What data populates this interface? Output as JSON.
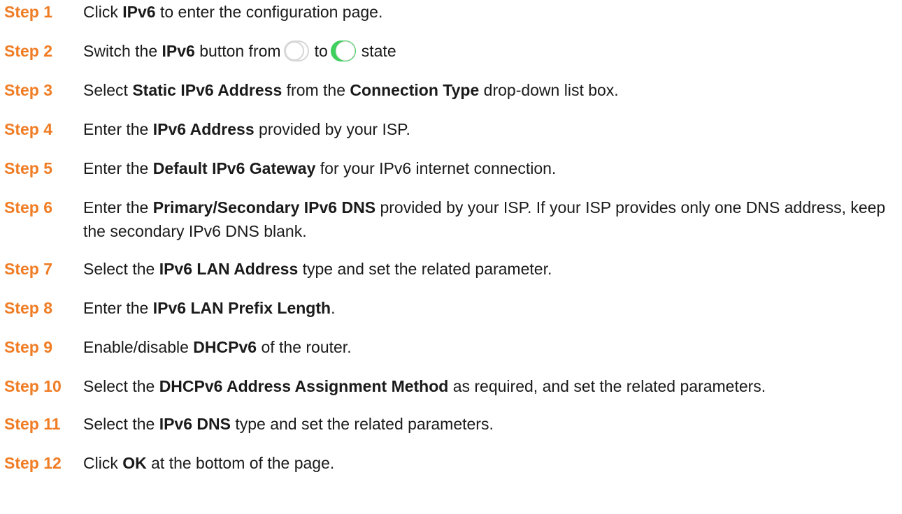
{
  "steps": [
    {
      "label": "Step 1",
      "parts": [
        "Click ",
        "IPv6",
        " to enter the configuration page."
      ]
    },
    {
      "label": "Step 2",
      "parts": [
        "Switch the ",
        "IPv6",
        " button from",
        "to",
        "state"
      ],
      "toggle_off": "toggle-off-icon",
      "toggle_on": "toggle-on-icon"
    },
    {
      "label": "Step 3",
      "parts": [
        "Select ",
        "Static IPv6 Address",
        " from the ",
        "Connection Type",
        " drop-down list box."
      ]
    },
    {
      "label": "Step 4",
      "parts": [
        "Enter the ",
        "IPv6 Address",
        " provided by your ISP."
      ]
    },
    {
      "label": "Step 5",
      "parts": [
        "Enter the ",
        "Default IPv6 Gateway",
        " for your IPv6 internet connection."
      ]
    },
    {
      "label": "Step 6",
      "parts": [
        "Enter the ",
        "Primary/Secondary IPv6 DNS",
        " provided by your ISP. If your ISP provides only one DNS address, keep the secondary IPv6 DNS blank."
      ]
    },
    {
      "label": "Step 7",
      "parts": [
        "Select the ",
        "IPv6 LAN Address",
        " type and set the related parameter."
      ]
    },
    {
      "label": "Step 8",
      "parts": [
        "Enter the ",
        "IPv6 LAN Prefix Length",
        "."
      ]
    },
    {
      "label": "Step 9",
      "parts": [
        "Enable/disable ",
        "DHCPv6",
        " of the router."
      ]
    },
    {
      "label": "Step 10",
      "parts": [
        "Select the ",
        "DHCPv6 Address Assignment Method",
        " as required, and set the related parameters."
      ]
    },
    {
      "label": "Step 11",
      "parts": [
        "Select the ",
        "IPv6 DNS",
        " type and set the related parameters."
      ]
    },
    {
      "label": "Step 12",
      "parts": [
        "Click ",
        "OK",
        " at the bottom of the page."
      ]
    }
  ],
  "colors": {
    "step_label": "#f07c24",
    "toggle_on": "#3ecf5c",
    "toggle_off_border": "#d6d6d6"
  }
}
